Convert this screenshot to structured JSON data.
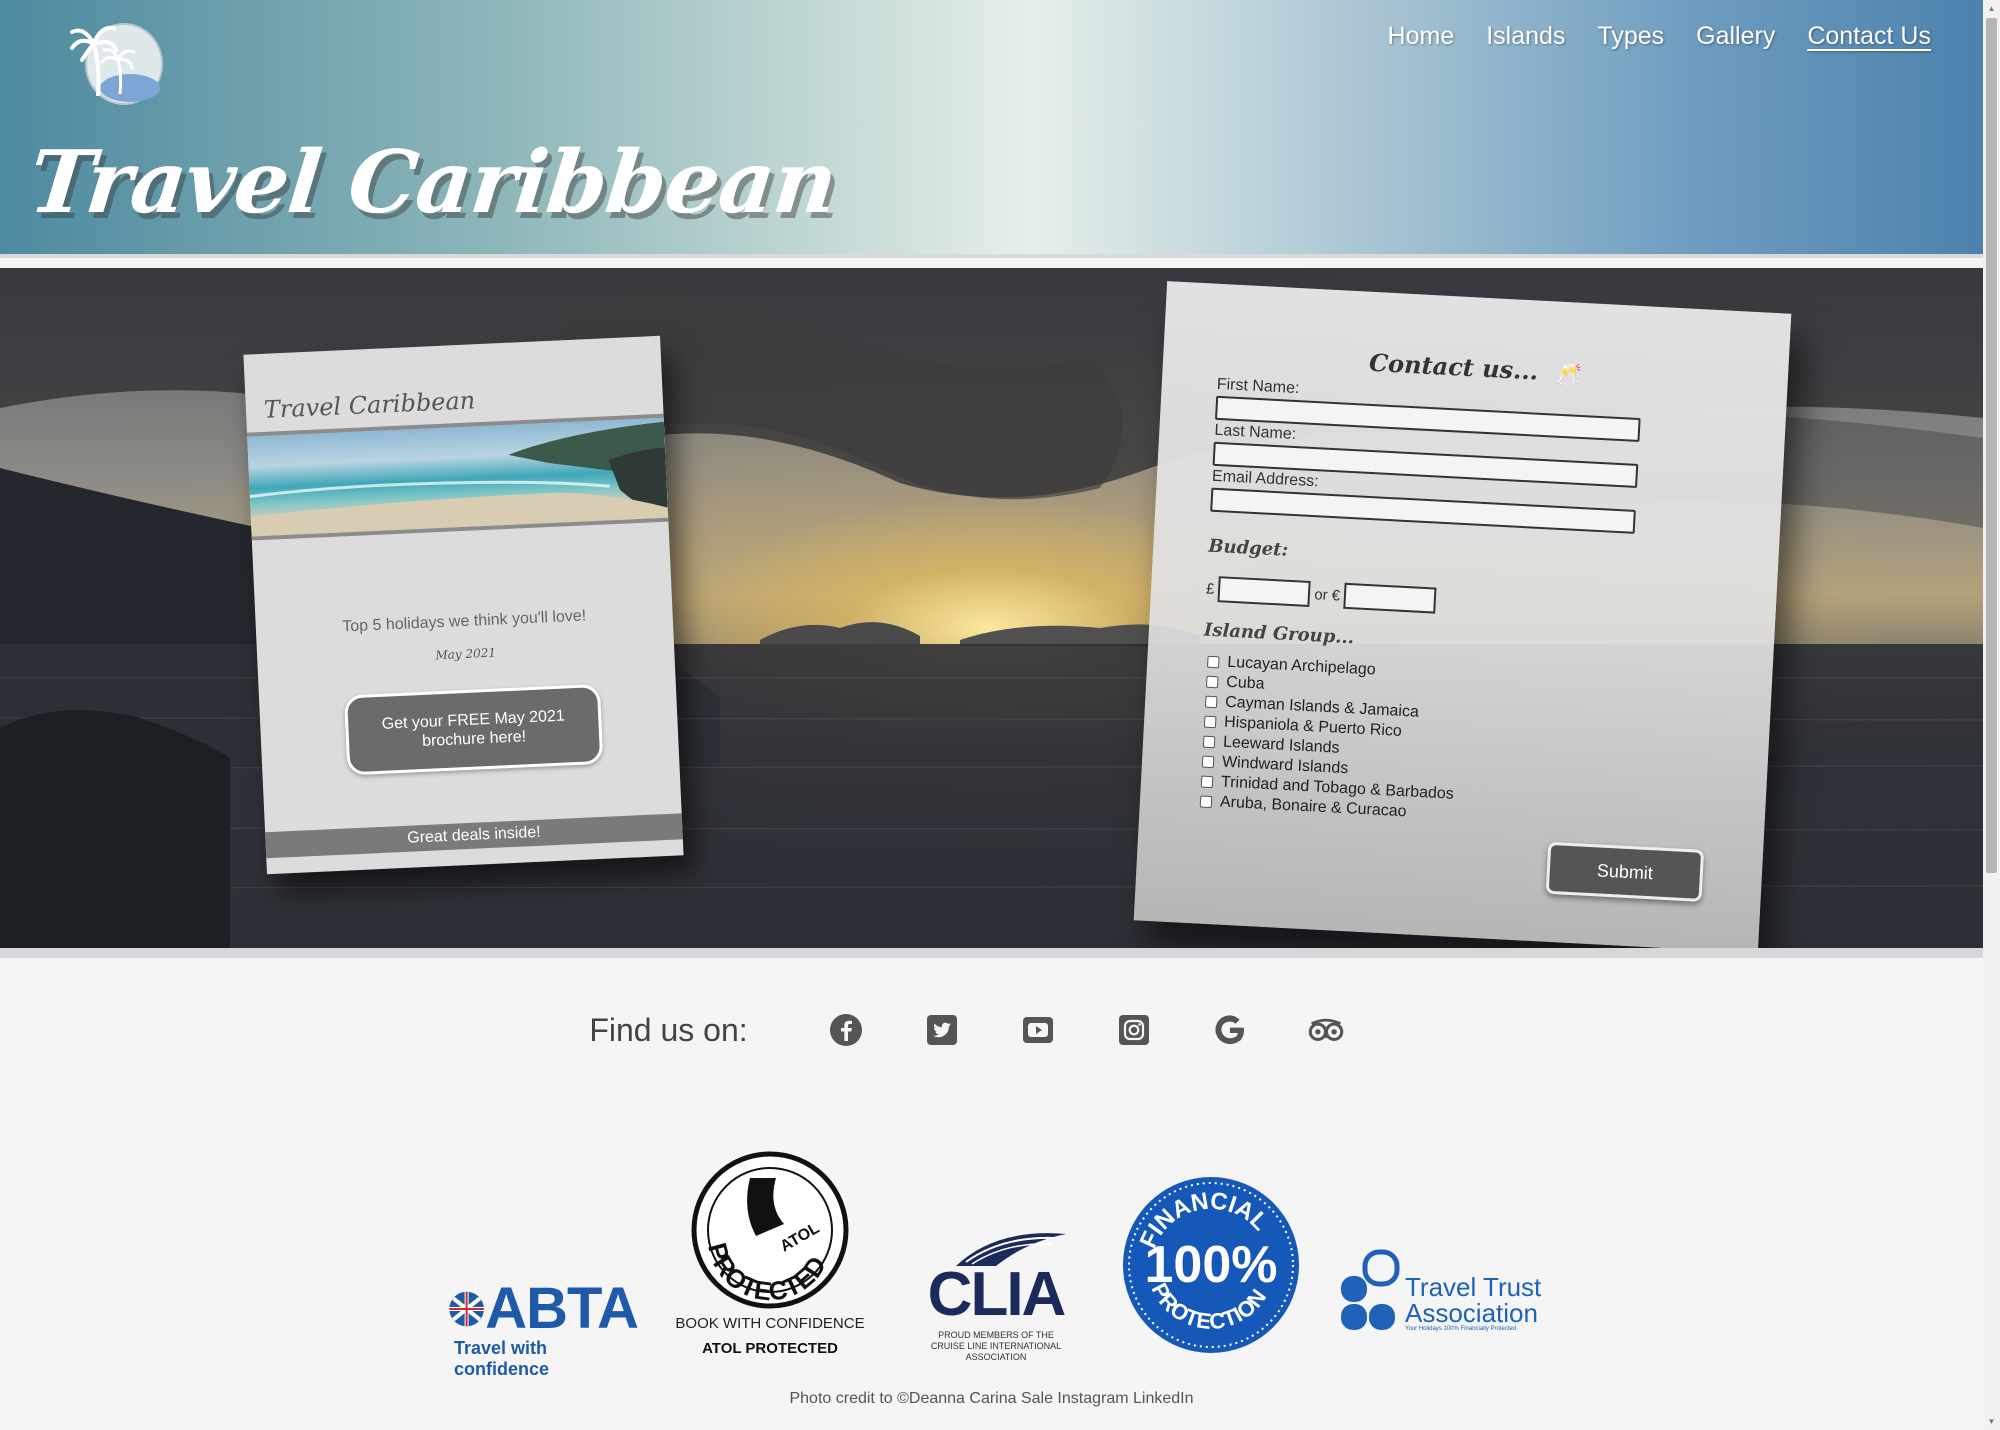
{
  "header": {
    "site_title": "Travel Caribbean",
    "nav": [
      {
        "label": "Home"
      },
      {
        "label": "Islands"
      },
      {
        "label": "Types"
      },
      {
        "label": "Gallery"
      },
      {
        "label": "Contact Us",
        "active": true
      }
    ]
  },
  "brochure": {
    "title": "Travel Caribbean",
    "tagline": "Top 5 holidays we think you'll love!",
    "date": "May 2021",
    "button_label": "Get your FREE May 2021 brochure here!",
    "footer": "Great deals inside!"
  },
  "contact_form": {
    "title": "Contact us...",
    "fields": {
      "first_name_label": "First Name:",
      "last_name_label": "Last Name:",
      "email_label": "Email Address:"
    },
    "budget": {
      "label": "Budget:",
      "pound_symbol": "£",
      "or_euro": "or €"
    },
    "island_group": {
      "label": "Island Group...",
      "options": [
        "Lucayan Archipelago",
        "Cuba",
        "Cayman Islands & Jamaica",
        "Hispaniola & Puerto Rico",
        "Leeward Islands",
        "Windward Islands",
        "Trinidad and Tobago & Barbados",
        "Aruba, Bonaire & Curacao"
      ]
    },
    "submit_label": "Submit"
  },
  "social": {
    "label": "Find us on:",
    "icons": [
      "facebook-icon",
      "twitter-icon",
      "youtube-icon",
      "instagram-icon",
      "google-icon",
      "tripadvisor-icon"
    ]
  },
  "logos": {
    "abta": {
      "name": "ABTA",
      "tagline": "Travel with confidence"
    },
    "atol": {
      "ring_text": "ATOL PROTECTED",
      "line1": "BOOK WITH CONFIDENCE",
      "line2": "ATOL PROTECTED"
    },
    "clia": {
      "name": "CLIA",
      "line1": "PROUD MEMBERS OF THE",
      "line2": "CRUISE LINE INTERNATIONAL ASSOCIATION"
    },
    "financial": {
      "top": "FINANCIAL",
      "middle": "100%",
      "bottom": "PROTECTION"
    },
    "tta": {
      "line1": "Travel Trust",
      "line2": "Association",
      "tagline": "Your Holidays 100% Financially Protected"
    }
  },
  "footer": {
    "credit": "Photo credit to ©Deanna Carina Sale Instagram LinkedIn"
  },
  "colors": {
    "header_gradient_mid": "#e6efea",
    "header_gradient_edge": "#4c82ad",
    "abta_blue": "#1e5aa8",
    "financial_blue": "#1558b8",
    "tta_blue": "#1e63b8"
  }
}
